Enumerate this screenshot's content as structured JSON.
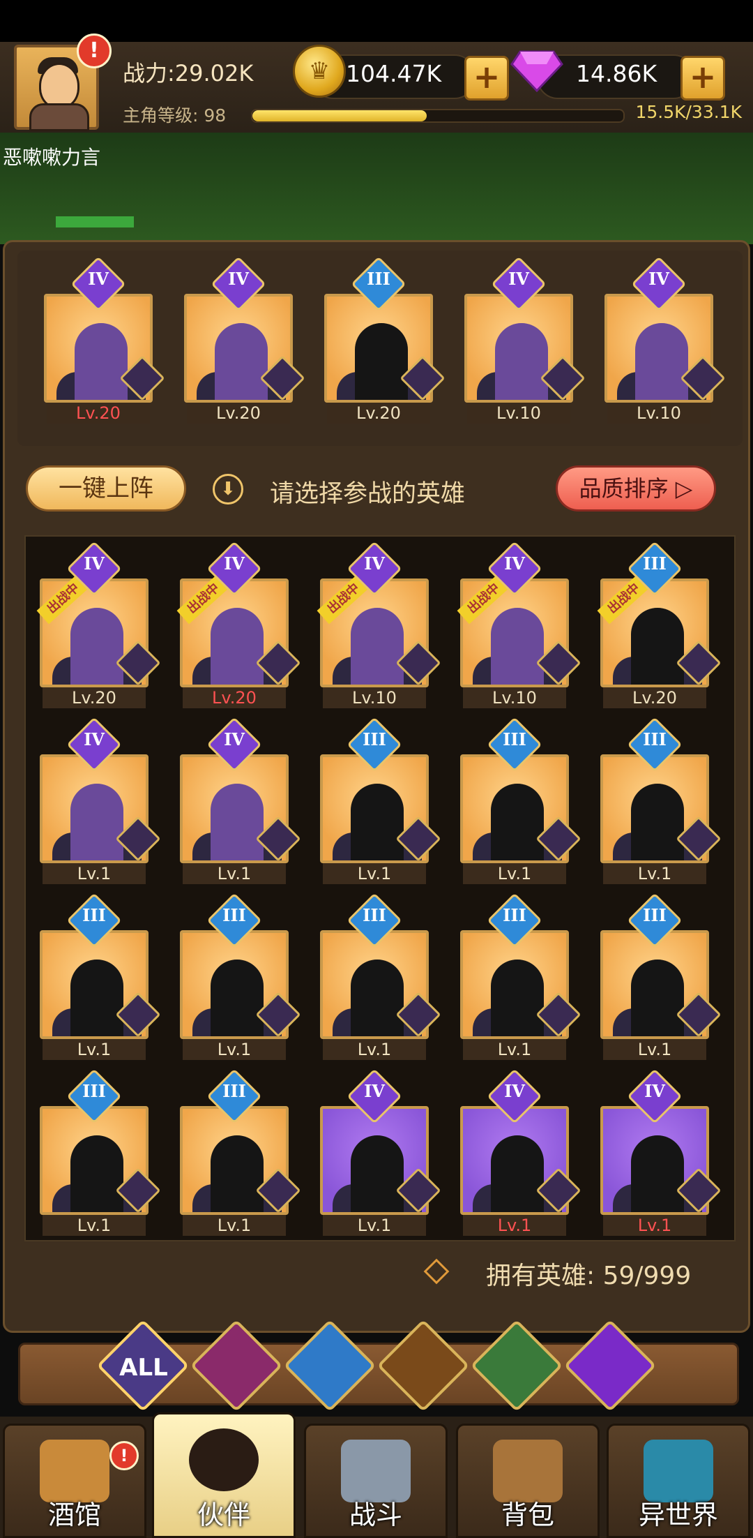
{
  "header": {
    "power": "战力:29.02K",
    "level_label": "主角等级:  98",
    "xp": "15.5K/33.1K",
    "xp_progress": 0.47,
    "gold": "104.47K",
    "gems": "14.86K",
    "player_name": "恶嗽嗽力言"
  },
  "team": [
    {
      "rank": "IV",
      "level": "Lv.20",
      "level_red": true
    },
    {
      "rank": "IV",
      "level": "Lv.20",
      "level_red": false
    },
    {
      "rank": "III",
      "level": "Lv.20",
      "level_red": false
    },
    {
      "rank": "IV",
      "level": "Lv.10",
      "level_red": false
    },
    {
      "rank": "IV",
      "level": "Lv.10",
      "level_red": false
    }
  ],
  "controls": {
    "one_key_label": "一键上阵",
    "hint": "请选择参战的英雄",
    "sort_label": "品质排序 ▷",
    "deployed_tag": "出战中"
  },
  "heroes": [
    {
      "rank": "IV",
      "level": "Lv.20",
      "deployed": true
    },
    {
      "rank": "IV",
      "level": "Lv.20",
      "deployed": true,
      "level_red": true
    },
    {
      "rank": "IV",
      "level": "Lv.10",
      "deployed": true
    },
    {
      "rank": "IV",
      "level": "Lv.10",
      "deployed": true
    },
    {
      "rank": "III",
      "level": "Lv.20",
      "deployed": true
    },
    {
      "rank": "IV",
      "level": "Lv.1"
    },
    {
      "rank": "IV",
      "level": "Lv.1"
    },
    {
      "rank": "III",
      "level": "Lv.1"
    },
    {
      "rank": "III",
      "level": "Lv.1"
    },
    {
      "rank": "III",
      "level": "Lv.1"
    },
    {
      "rank": "III",
      "level": "Lv.1"
    },
    {
      "rank": "III",
      "level": "Lv.1"
    },
    {
      "rank": "III",
      "level": "Lv.1"
    },
    {
      "rank": "III",
      "level": "Lv.1"
    },
    {
      "rank": "III",
      "level": "Lv.1"
    },
    {
      "rank": "III",
      "level": "Lv.1"
    },
    {
      "rank": "III",
      "level": "Lv.1"
    },
    {
      "rank": "IV",
      "level": "Lv.1",
      "purple": true
    },
    {
      "rank": "IV",
      "level": "Lv.1",
      "purple": true,
      "level_red": true
    },
    {
      "rank": "IV",
      "level": "Lv.1",
      "purple": true,
      "level_red": true
    }
  ],
  "hero_count": "拥有英雄:  59/999",
  "filters": [
    "ALL",
    "knight-faction-icon",
    "fish-faction-icon",
    "lion-faction-icon",
    "elf-faction-icon",
    "demon-faction-icon"
  ],
  "nav": [
    {
      "label": "酒馆",
      "icon": "tavern-icon"
    },
    {
      "label": "伙伴",
      "icon": "partner-icon"
    },
    {
      "label": "战斗",
      "icon": "battle-icon"
    },
    {
      "label": "背包",
      "icon": "backpack-icon"
    },
    {
      "label": "异世界",
      "icon": "otherworld-icon"
    }
  ],
  "colors": {
    "accent": "#f0c56a",
    "purple_rank": "#7a3fcf",
    "blue_rank": "#2f8ad8",
    "alert": "#e23a2a"
  }
}
